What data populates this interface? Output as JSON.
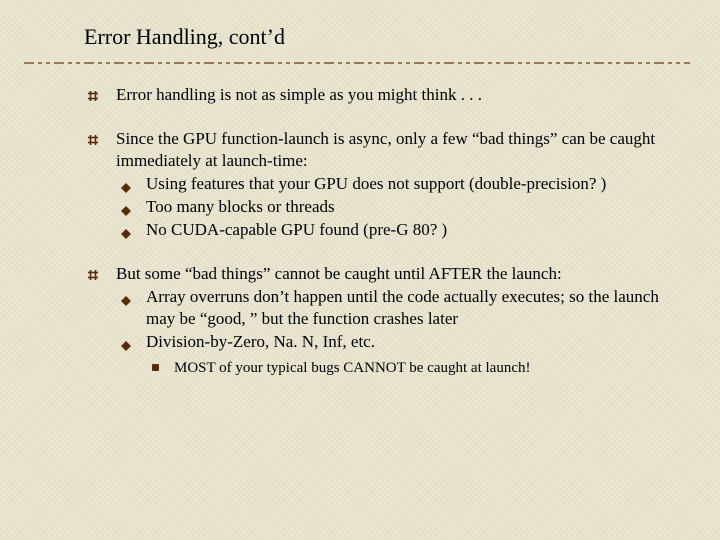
{
  "title": "Error Handling, cont’d",
  "bullets": [
    {
      "text": "Error handling is not as simple as you might think . . .",
      "sub": [],
      "note": null
    },
    {
      "text": "Since the GPU function-launch is async, only a few “bad things” can be caught immediately at launch-time:",
      "sub": [
        "Using features that your GPU does not support (double-precision? )",
        "Too many blocks or threads",
        "No CUDA-capable GPU found (pre-G 80? )"
      ],
      "note": null
    },
    {
      "text": "But some “bad things” cannot be caught until AFTER the launch:",
      "sub": [
        "Array overruns don’t happen until the code actually executes; so the launch may be “good, ” but the function crashes later",
        "Division-by-Zero, Na. N, Inf, etc."
      ],
      "note": "MOST of your typical bugs CANNOT be caught at launch!"
    }
  ],
  "colors": {
    "rule": "#6a3810",
    "bullet": "#5a2a0a"
  }
}
